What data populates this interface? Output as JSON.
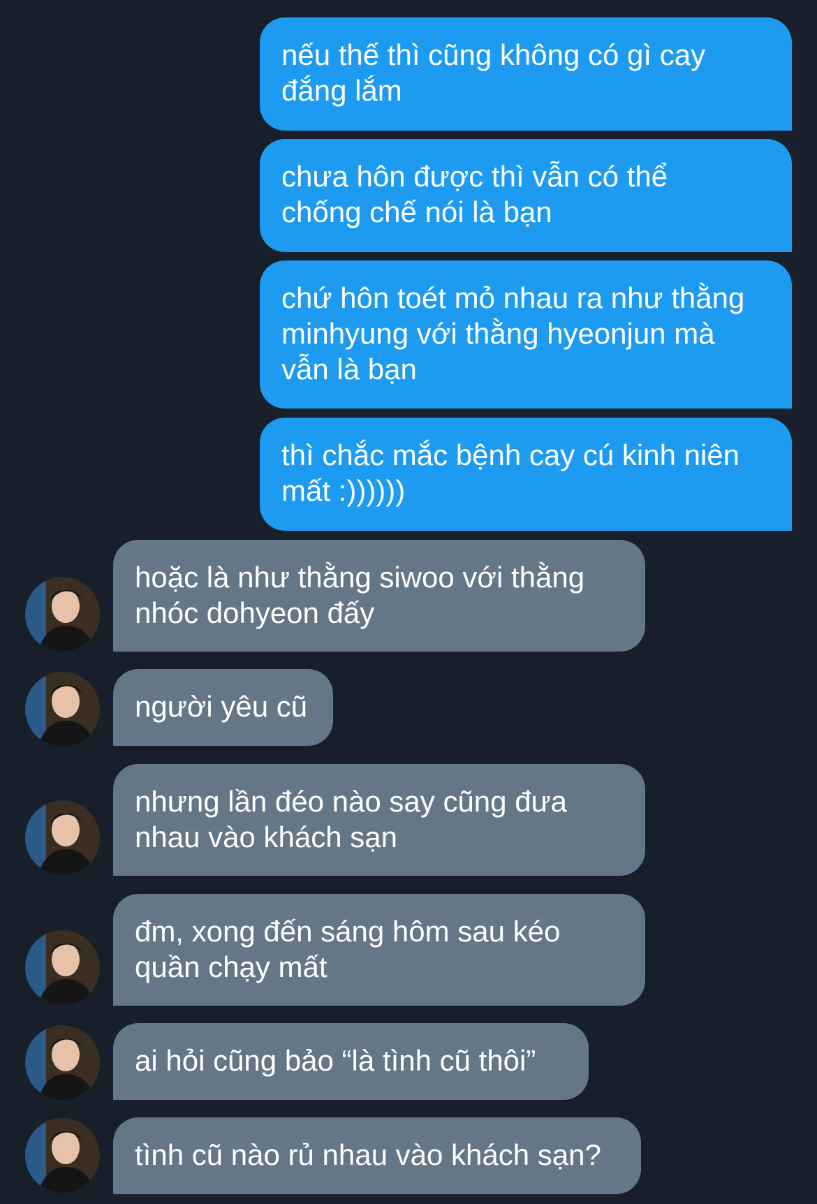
{
  "conversation": {
    "outgoing": [
      {
        "text": "nếu thế thì cũng không có gì cay\nđắng lắm"
      },
      {
        "text": "chưa hôn được thì vẫn có thể\nchống chế nói là bạn"
      },
      {
        "text": "chứ hôn toét mỏ nhau ra như thằng\nminhyung với thằng hyeonjun mà\nvẫn là bạn"
      },
      {
        "text": "thì chắc mắc bệnh cay cú kinh niên\nmất :))))))"
      }
    ],
    "incoming": [
      {
        "text": "hoặc là như thằng siwoo với thằng\nnhóc dohyeon đấy"
      },
      {
        "text": "người yêu cũ"
      },
      {
        "text": "nhưng lần đéo nào say cũng đưa\nnhau vào khách sạn"
      },
      {
        "text": "đm, xong đến sáng hôm sau kéo\nquần chạy mất"
      },
      {
        "text": "ai hỏi cũng bảo “là tình cũ thôi”"
      },
      {
        "text": "tình cũ nào rủ nhau vào khách sạn?"
      }
    ]
  },
  "colors": {
    "background": "#17202a",
    "outgoing_bubble": "#1d9bf0",
    "incoming_bubble": "#657786",
    "text": "#ffffff"
  },
  "icons": {
    "avatar": "profile-photo-avatar"
  }
}
